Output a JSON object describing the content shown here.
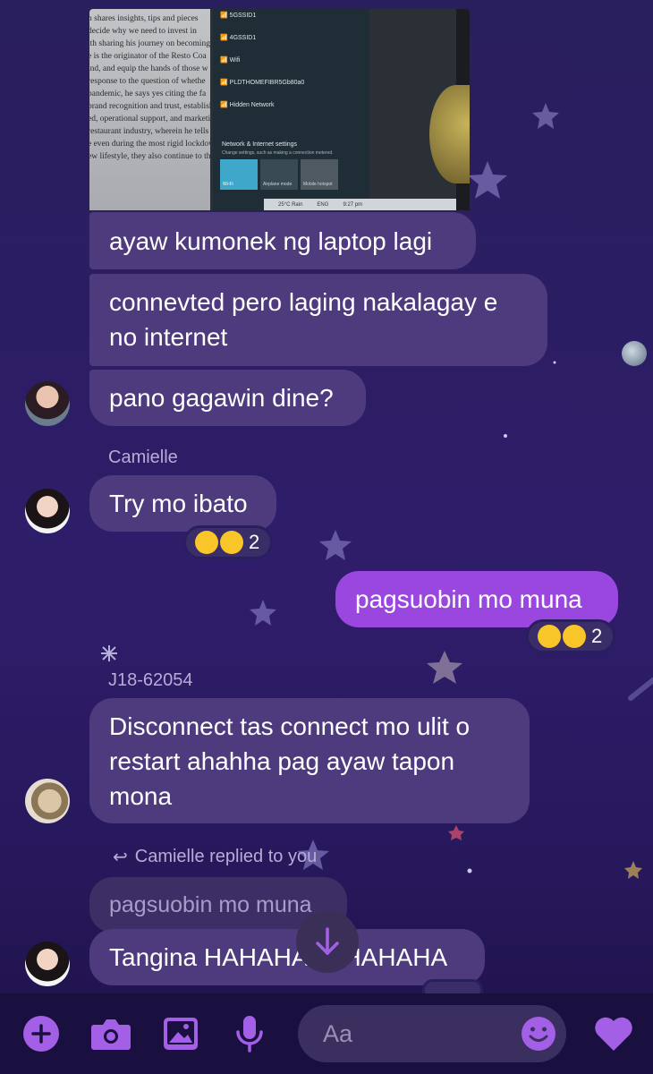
{
  "messages": {
    "m1": "ayaw kumonek ng laptop lagi",
    "m2": "connevted pero laging nakalagay e no internet",
    "m3": "pano gagawin dine?",
    "m4_sender": "Camielle",
    "m4": "Try mo ibato",
    "m4_react_count": "2",
    "m5": "pagsuobin mo muna",
    "m5_react_count": "2",
    "m6_sender": "J18-62054",
    "m6": "Disconnect tas connect mo ulit o restart ahahha pag ayaw tapon mona",
    "reply_header": "Camielle replied to you",
    "reply_quote": "pagsuobin mo muna",
    "m7": "Tangina HAHAHAHAHAHAHA"
  },
  "screenshot": {
    "doc_lines": [
      "h shares insights, tips and pieces",
      "decide why we need to invest in",
      "ith sharing his journey on becoming",
      "e is the originator of the Resto Coa",
      "ind, and equip the hands of those w",
      "response to the question of whethe",
      "pandemic, he says yes citing the fa",
      "brand recognition and trust, establish",
      "ed, operational support, and marketi",
      "restaurant industry, wherein he tells t",
      "e even during the most rigid lockdow",
      "ew lifestyle, they also continue to thri"
    ],
    "wifi_networks": [
      "5GSSID1",
      "4GSSID1",
      "Wifi",
      "PLDTHOMEFIBR5Gb80a0",
      "Hidden Network"
    ],
    "net_settings_title": "Network & Internet settings",
    "net_settings_sub": "Change settings, such as making a connection metered.",
    "tile_wifi": "Wi-Fi",
    "tile_airplane": "Airplane mode",
    "tile_mobile": "Mobile hotspot",
    "taskbar_weather": "25°C  Rain",
    "taskbar_lang": "ENG",
    "taskbar_time": "9:27 pm"
  },
  "composer": {
    "placeholder": "Aa"
  },
  "colors": {
    "bubble_other": "#4d3b7e",
    "bubble_me": "#9a47e0",
    "icon_accent": "#a35fe6"
  }
}
